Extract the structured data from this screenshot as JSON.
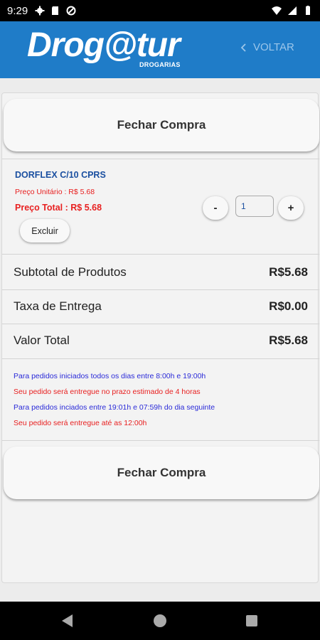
{
  "status_bar": {
    "time": "9:29"
  },
  "header": {
    "logo": "Drog@tur",
    "logo_sub": "DROGARIAS",
    "back_label": "VOLTAR"
  },
  "buttons": {
    "checkout_top": "Fechar Compra",
    "checkout_bottom": "Fechar Compra"
  },
  "cart_item": {
    "name": "DORFLEX C/10 CPRS",
    "unit_price": "Preço Unitário : R$ 5.68",
    "total_price": "Preço Total : R$ 5.68",
    "remove_label": "Excluir",
    "decrement_label": "-",
    "increment_label": "+",
    "quantity": "1"
  },
  "summary": [
    {
      "label": "Subtotal de Produtos",
      "value": "R$5.68"
    },
    {
      "label": "Taxa de Entrega",
      "value": "R$0.00"
    },
    {
      "label": "Valor Total",
      "value": "R$5.68"
    }
  ],
  "delivery_info": [
    {
      "text": "Para pedidos iniciados todos os dias entre 8:00h e 19:00h",
      "color": "#2a2ad8"
    },
    {
      "text": "Seu pedido será entregue no prazo estimado de 4 horas",
      "color": "#e82020"
    },
    {
      "text": "Para pedidos inciados entre 19:01h e 07:59h do dia seguinte",
      "color": "#2a2ad8"
    },
    {
      "text": "Seu pedido será entregue até as 12:00h",
      "color": "#e82020"
    }
  ],
  "colors": {
    "header": "#1f7cc8",
    "accent_blue": "#1a4fa0",
    "price_red": "#e82020"
  }
}
